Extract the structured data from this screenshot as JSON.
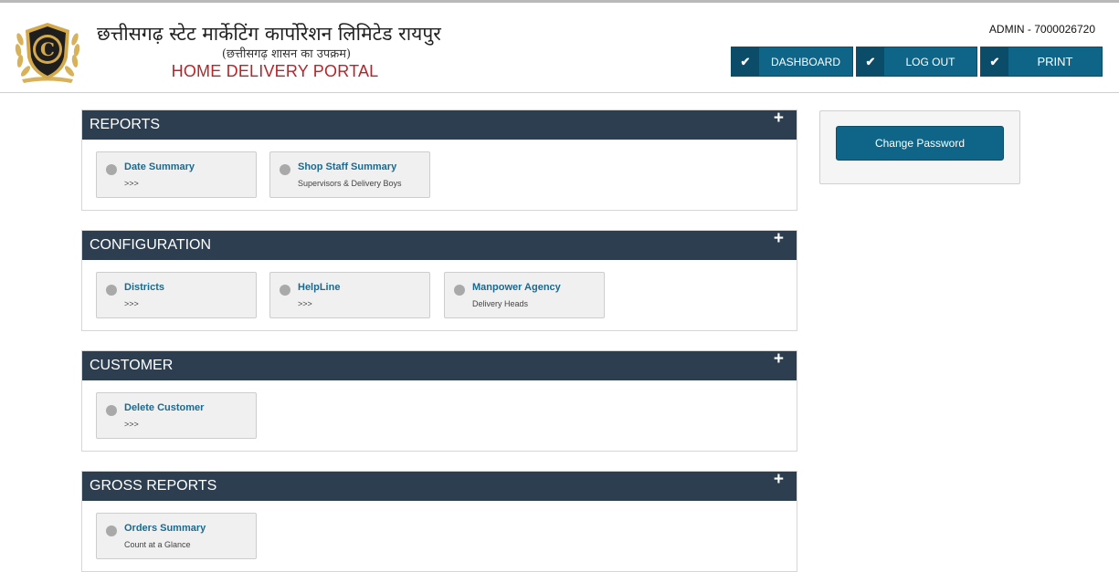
{
  "header": {
    "title_hindi": "छत्तीसगढ़ स्टेट मार्केटिंग कार्पोरेशन लिमिटेड रायपुर",
    "subtitle_hindi": "(छत्तीसगढ़ शासन का उपक्रम)",
    "portal_name": "HOME DELIVERY PORTAL",
    "admin_label": "ADMIN - 7000026720",
    "logo_letter": "C",
    "buttons": [
      {
        "label": "DASHBOARD",
        "icon": "check-icon",
        "check": "✔"
      },
      {
        "label": "LOG OUT",
        "icon": "check-icon",
        "check": "✔"
      },
      {
        "label": "PRINT",
        "icon": "check-icon",
        "check": "✔"
      }
    ]
  },
  "panels": [
    {
      "title": "REPORTS",
      "plus": "+",
      "tiles": [
        {
          "title": "Date Summary",
          "sub": ">>>"
        },
        {
          "title": "Shop Staff Summary",
          "sub": "Supervisors & Delivery Boys"
        }
      ]
    },
    {
      "title": "CONFIGURATION",
      "plus": "+",
      "tiles": [
        {
          "title": "Districts",
          "sub": ">>>"
        },
        {
          "title": "HelpLine",
          "sub": ">>>"
        },
        {
          "title": "Manpower Agency",
          "sub": "Delivery Heads"
        }
      ]
    },
    {
      "title": "CUSTOMER",
      "plus": "+",
      "tiles": [
        {
          "title": "Delete Customer",
          "sub": ">>>"
        }
      ]
    },
    {
      "title": "GROSS REPORTS",
      "plus": "+",
      "tiles": [
        {
          "title": "Orders Summary",
          "sub": "Count at a Glance"
        }
      ]
    }
  ],
  "sidebar": {
    "change_password_label": "Change Password"
  },
  "colors": {
    "panel_header": "#2d3e50",
    "button": "#0f6587",
    "portal_title": "#b3262b",
    "tile_title": "#1a6a90"
  }
}
